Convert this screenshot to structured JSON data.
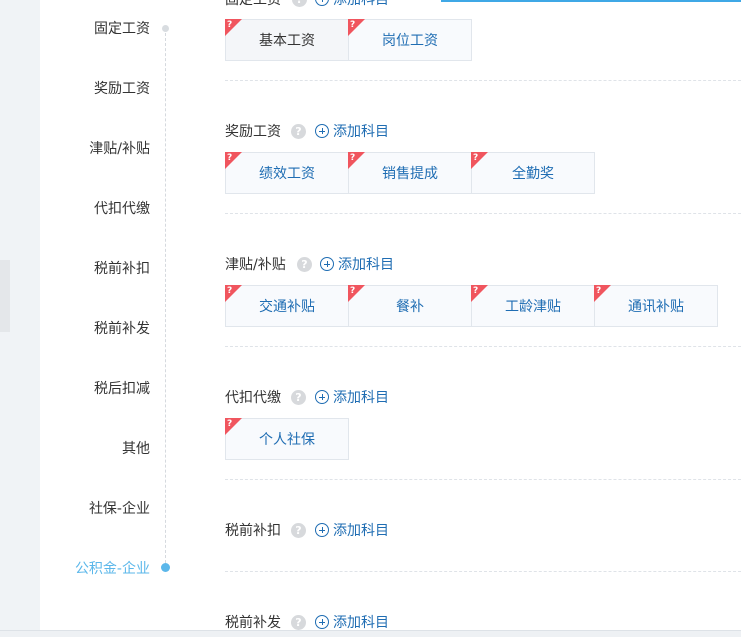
{
  "nav": {
    "items": [
      {
        "label": "固定工资"
      },
      {
        "label": "奖励工资"
      },
      {
        "label": "津贴/补贴"
      },
      {
        "label": "代扣代缴"
      },
      {
        "label": "税前补扣"
      },
      {
        "label": "税前补发"
      },
      {
        "label": "税后扣减"
      },
      {
        "label": "其他"
      },
      {
        "label": "社保-企业"
      },
      {
        "label": "公积金-企业"
      }
    ],
    "active_index": 9
  },
  "add_label": "添加科目",
  "help_glyph": "?",
  "sections": [
    {
      "title": "固定工资",
      "items": [
        "基本工资",
        "岗位工资"
      ]
    },
    {
      "title": "奖励工资",
      "items": [
        "绩效工资",
        "销售提成",
        "全勤奖"
      ]
    },
    {
      "title": "津贴/补贴",
      "items": [
        "交通补贴",
        "餐补",
        "工龄津贴",
        "通讯补贴"
      ]
    },
    {
      "title": "代扣代缴",
      "items": [
        "个人社保"
      ]
    },
    {
      "title": "税前补扣",
      "items": []
    },
    {
      "title": "税前补发",
      "items": []
    }
  ],
  "colors": {
    "accent": "#5bb7ea",
    "link": "#1f6db3",
    "flag": "#f0555e"
  }
}
